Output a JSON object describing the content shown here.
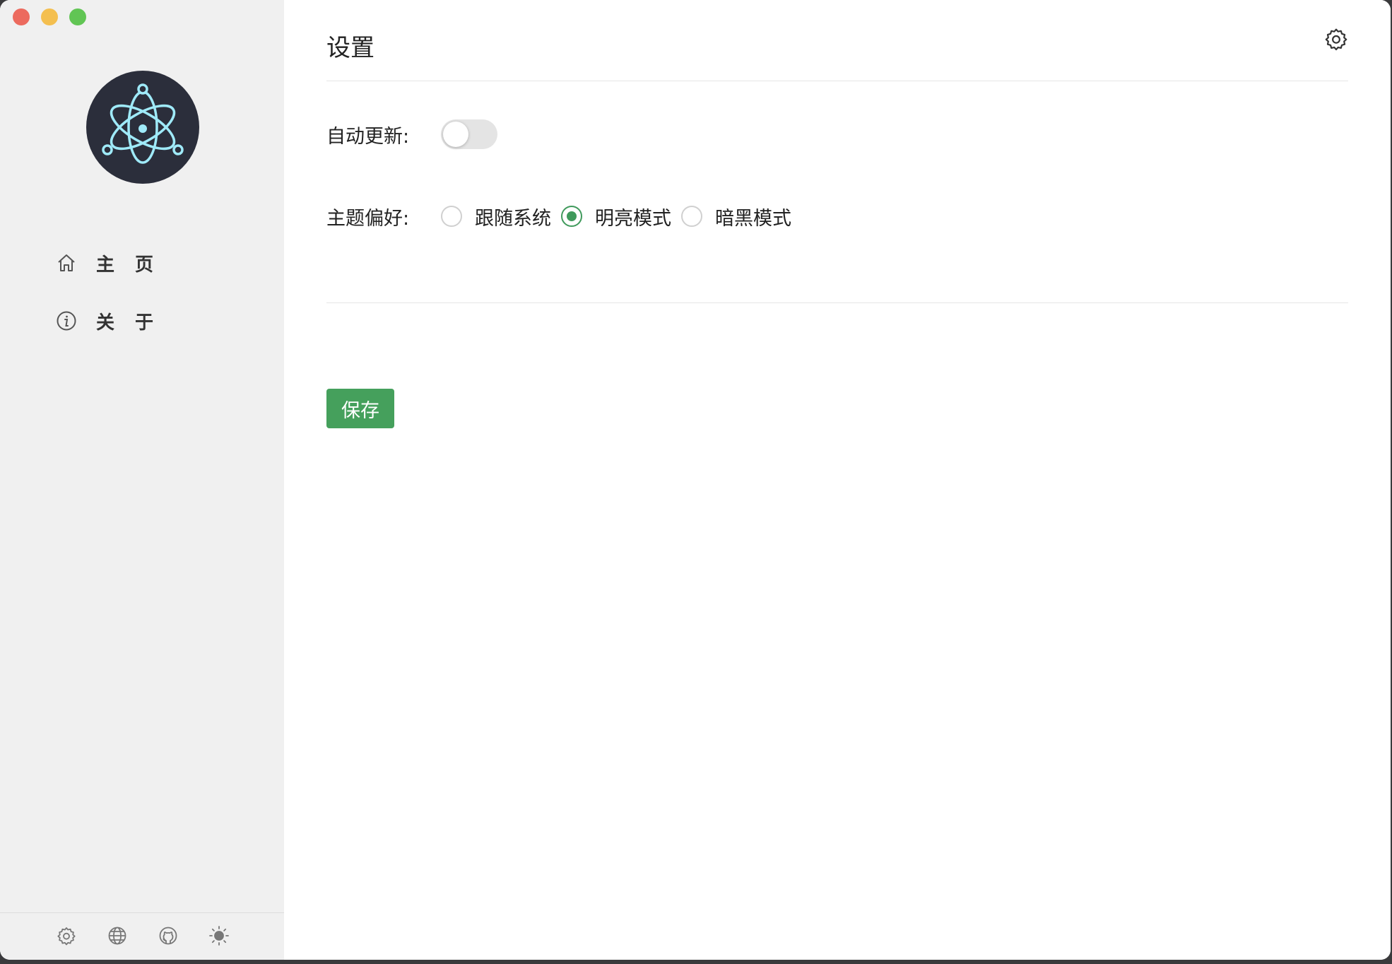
{
  "window": {
    "controls": [
      "close",
      "minimize",
      "zoom"
    ]
  },
  "sidebar": {
    "logo": "electron-atom-logo",
    "items": [
      {
        "label": "主 页",
        "icon": "home-icon"
      },
      {
        "label": "关 于",
        "icon": "info-icon"
      }
    ],
    "footer_icons": [
      "gear-icon",
      "globe-icon",
      "github-icon",
      "sun-icon"
    ]
  },
  "main": {
    "title": "设置",
    "header_icon": "gear-icon",
    "auto_update": {
      "label": "自动更新:",
      "enabled": false
    },
    "theme": {
      "label": "主题偏好:",
      "options": [
        "跟随系统",
        "明亮模式",
        "暗黑模式"
      ],
      "selected": "明亮模式"
    },
    "save_label": "保存"
  },
  "colors": {
    "accent": "#45a05c",
    "sidebar_bg": "#f0f0f0",
    "logo_bg": "#2b2e3b",
    "logo_fg": "#9feaf9"
  }
}
